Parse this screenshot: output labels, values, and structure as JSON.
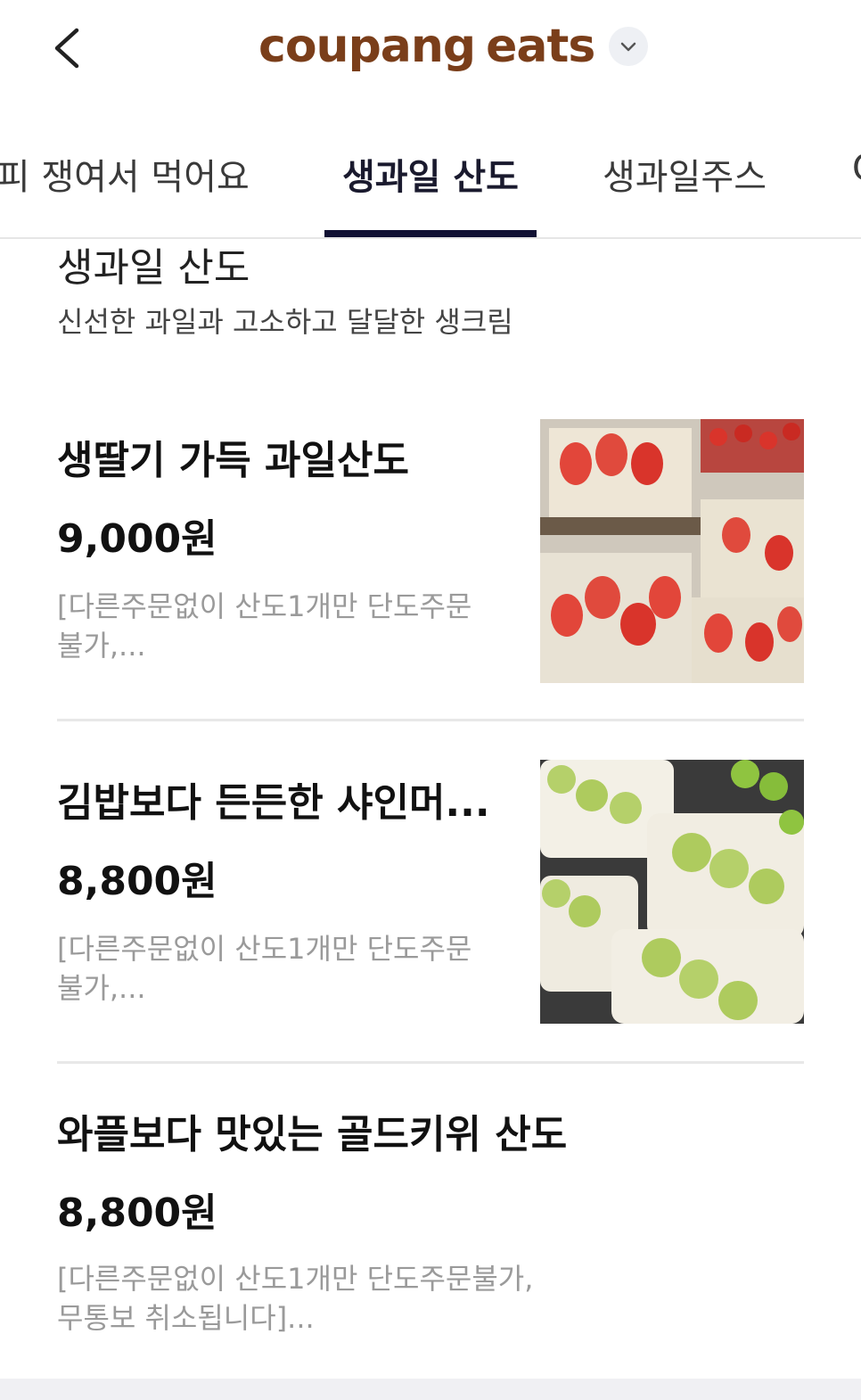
{
  "header": {
    "back_icon": "chevron-left-icon",
    "brand_part1": "coupang",
    "brand_part2": "eats",
    "dropdown_icon": "chevron-down-icon",
    "brand_colors": {
      "coupang": "#7a3e1a",
      "eats": "#7a3e1a"
    }
  },
  "tabs": [
    {
      "label": "컵피 쟁여서 먹어요",
      "active": false
    },
    {
      "label": "생과일 산도",
      "active": true
    },
    {
      "label": "생과일주스",
      "active": false
    },
    {
      "label": "C",
      "active": false
    }
  ],
  "section": {
    "title": "생과일 산도",
    "description": "신선한 과일과 고소하고 달달한 생크림"
  },
  "items": [
    {
      "name": "생딸기 가득 과일산도",
      "price": "9,000원",
      "desc_line1": "[다른주문없이 산도1개만 단도주문",
      "desc_line2": "불가,...",
      "image": "strawberry-sando-photo"
    },
    {
      "name": "김밥보다 든든한 샤인머...",
      "price": "8,800원",
      "desc_line1": "[다른주문없이 산도1개만 단도주문",
      "desc_line2": "불가,...",
      "image": "shine-muscat-sando-photo"
    },
    {
      "name": "와플보다 맛있는 골드키위 산도",
      "price": "8,800원",
      "desc_line1": "[다른주문없이 산도1개만 단도주문불가,",
      "desc_line2": "무통보 취소됩니다]..."
    }
  ]
}
